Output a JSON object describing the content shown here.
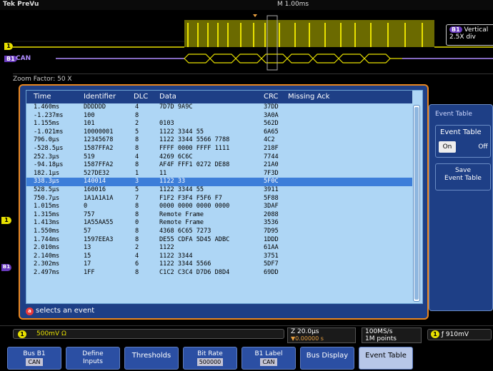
{
  "topbar": {
    "brand": "Tek PreVu",
    "timebase": "M 1.00ms"
  },
  "overview": {
    "vertical_label": "Vertical",
    "vertical_value": "2.5X div",
    "bus_badge": "B1",
    "bus_name": "CAN",
    "ch1_marker": "1"
  },
  "zoom_factor": "Zoom Factor: 50 X",
  "table": {
    "columns": [
      "Time",
      "Identifier",
      "DLC",
      "Data",
      "CRC",
      "Missing Ack"
    ],
    "rows": [
      [
        "1.460ms",
        "DDDDDD",
        "4",
        "7D7D 9A9C",
        "37DD",
        ""
      ],
      [
        "-1.237ms",
        "100",
        "8",
        "",
        "3A0A",
        ""
      ],
      [
        "1.155ms",
        "101",
        "2",
        "0103",
        "562D",
        ""
      ],
      [
        "-1.021ms",
        "10000001",
        "5",
        "1122 3344 55",
        "6A65",
        ""
      ],
      [
        "796.0µs",
        "12345678",
        "8",
        "1122 3344 5566 7788",
        "4C2",
        ""
      ],
      [
        "-528.5µs",
        "1587FFA2",
        "8",
        "FFFF 0000 FFFF 1111",
        "218F",
        ""
      ],
      [
        "252.3µs",
        "519",
        "4",
        "4269 6C6C",
        "7744",
        ""
      ],
      [
        "-94.18µs",
        "1587FFA2",
        "8",
        "AF4F FFF1 0272 DE88",
        "21A0",
        ""
      ],
      [
        "182.1µs",
        "527DE32",
        "1",
        "11",
        "7F3D",
        ""
      ],
      [
        "338.3µs",
        "140014",
        "3",
        "1122 33",
        "5F0C",
        ""
      ],
      [
        "528.5µs",
        "160016",
        "5",
        "1122 3344 55",
        "3911",
        ""
      ],
      [
        "750.7µs",
        "1A1A1A1A",
        "7",
        "F1F2 F3F4 F5F6 F7",
        "5F88",
        ""
      ],
      [
        "1.015ms",
        "0",
        "8",
        "0000 0000 0000 0000",
        "3DAF",
        ""
      ],
      [
        "1.315ms",
        "757",
        "8",
        "Remote Frame",
        "2088",
        ""
      ],
      [
        "1.413ms",
        "1A55AA55",
        "0",
        "Remote Frame",
        "3536",
        ""
      ],
      [
        "1.550ms",
        "57",
        "8",
        "4368 6C65 7273",
        "7D95",
        ""
      ],
      [
        "1.744ms",
        "1597EEA3",
        "8",
        "DE55 CDFA 5D45 ADBC",
        "1DDD",
        ""
      ],
      [
        "2.010ms",
        "13",
        "2",
        "1122",
        "61AA",
        ""
      ],
      [
        "2.140ms",
        "15",
        "4",
        "1122 3344",
        "3751",
        ""
      ],
      [
        "2.302ms",
        "17",
        "6",
        "1122 3344 5566",
        "5DF7",
        ""
      ],
      [
        "2.497ms",
        "1FF",
        "8",
        "C1C2 C3C4 D7D6 D8D4",
        "69DD",
        ""
      ]
    ],
    "selected_index": 9,
    "hint_badge": "a",
    "hint_text": "selects an event"
  },
  "side_panel": {
    "title": "Event Table",
    "event_table_label": "Event Table",
    "on_label": "On",
    "off_label": "Off",
    "save_label_line1": "Save",
    "save_label_line2": "Event Table"
  },
  "left_markers": {
    "ch1": "1",
    "b1": "B1"
  },
  "status": {
    "ch1_badge": "1",
    "ch1_value": "500mV Ω",
    "hz_scale": "Z 20.0µs",
    "hz_position": "▼0.00000 s",
    "sample_rate": "100MS/s",
    "record_length": "1M points",
    "trigger_badge": "1",
    "trigger_value": "ƒ 910mV"
  },
  "softkeys": [
    {
      "line1": "Bus B1",
      "line2": "CAN"
    },
    {
      "line1": "Define",
      "line2": "Inputs"
    },
    {
      "line1": "Thresholds",
      "line2": ""
    },
    {
      "line1": "Bit Rate",
      "line2": "500000"
    },
    {
      "line1": "B1 Label",
      "line2": "CAN"
    },
    {
      "line1": "Bus Display",
      "line2": ""
    },
    {
      "line1": "Event Table",
      "line2": ""
    }
  ],
  "colors": {
    "ch1": "#e8e000",
    "bus": "#6a3bbf",
    "panel": "#1e3f86",
    "table_bg": "#aed6f5",
    "selected_row": "#3d7ed9",
    "frame_border": "#e9861f"
  }
}
